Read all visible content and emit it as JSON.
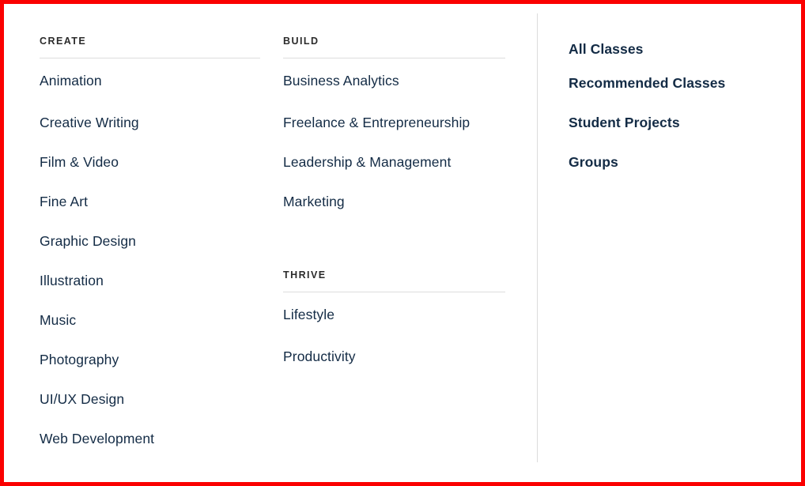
{
  "theme": {
    "background": "#ffffff",
    "text_color": "#132b45",
    "heading_color": "#2b2b2b",
    "rule_color": "#dddddd",
    "divider_color": "#dcdcdc",
    "highlight_border_color": "#fb0000"
  },
  "menu": {
    "sections": [
      {
        "heading": "CREATE",
        "items": [
          {
            "label": "Animation"
          },
          {
            "label": "Creative Writing"
          },
          {
            "label": "Film & Video"
          },
          {
            "label": "Fine Art"
          },
          {
            "label": "Graphic Design"
          },
          {
            "label": "Illustration"
          },
          {
            "label": "Music"
          },
          {
            "label": "Photography"
          },
          {
            "label": "UI/UX Design"
          },
          {
            "label": "Web Development"
          }
        ]
      },
      {
        "heading": "BUILD",
        "items": [
          {
            "label": "Business Analytics"
          },
          {
            "label": "Freelance & Entrepreneurship"
          },
          {
            "label": "Leadership & Management"
          },
          {
            "label": "Marketing"
          }
        ]
      },
      {
        "heading": "THRIVE",
        "items": [
          {
            "label": "Lifestyle"
          },
          {
            "label": "Productivity"
          }
        ]
      }
    ],
    "quick_links": [
      {
        "label": "All Classes"
      },
      {
        "label": "Recommended Classes"
      },
      {
        "label": "Student Projects"
      },
      {
        "label": "Groups"
      }
    ]
  }
}
